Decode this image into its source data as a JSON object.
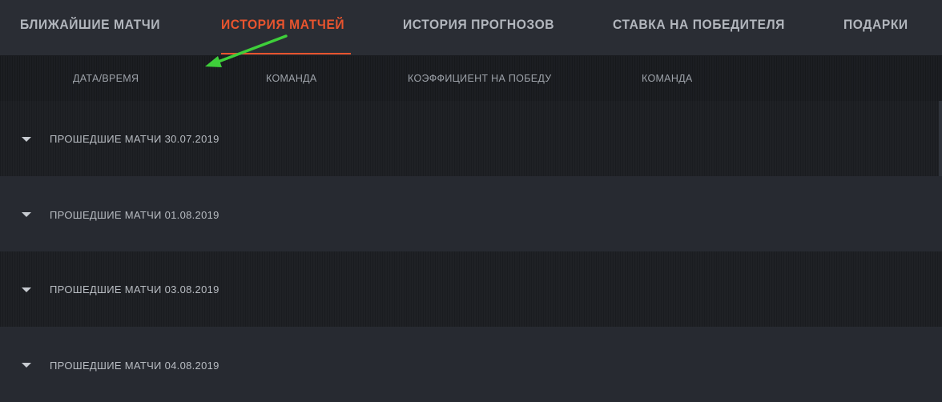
{
  "nav": {
    "tabs": [
      {
        "label": "БЛИЖАЙШИЕ МАТЧИ",
        "active": false
      },
      {
        "label": "ИСТОРИЯ МАТЧЕЙ",
        "active": true
      },
      {
        "label": "ИСТОРИЯ ПРОГНОЗОВ",
        "active": false
      },
      {
        "label": "СТАВКА НА ПОБЕДИТЕЛЯ",
        "active": false
      },
      {
        "label": "ПОДАРКИ",
        "active": false
      }
    ]
  },
  "table": {
    "columns": [
      "ДАТА/ВРЕМЯ",
      "КОМАНДА",
      "КОЭФФИЦИЕНТ НА ПОБЕДУ",
      "КОМАНДА"
    ]
  },
  "groups": [
    {
      "label": "ПРОШЕДШИЕ МАТЧИ 30.07.2019"
    },
    {
      "label": "ПРОШЕДШИЕ МАТЧИ 01.08.2019"
    },
    {
      "label": "ПРОШЕДШИЕ МАТЧИ 03.08.2019"
    },
    {
      "label": "ПРОШЕДШИЕ МАТЧИ 04.08.2019"
    }
  ],
  "colors": {
    "accent": "#e8542e",
    "annotation_arrow": "#3ecf3a"
  },
  "icons": {
    "group_toggle": "caret-down-icon",
    "annotation": "arrow-icon"
  }
}
